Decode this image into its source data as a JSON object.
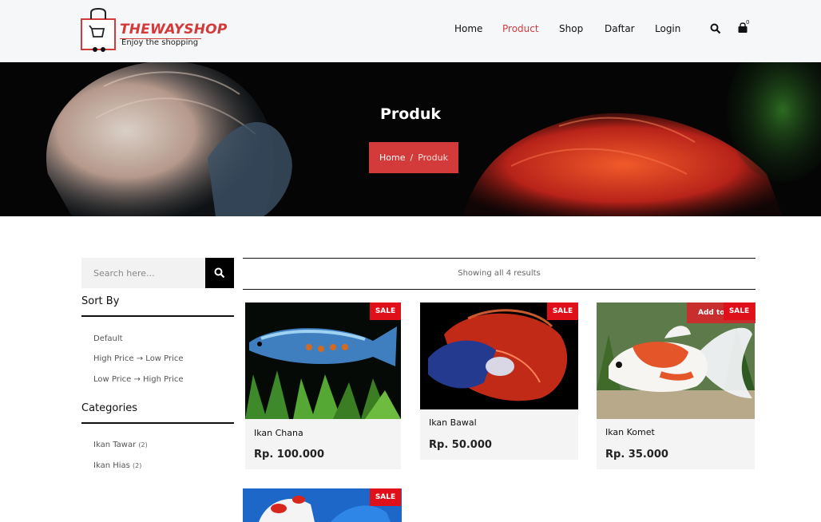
{
  "brand": {
    "title": "THEWAYSHOP",
    "tagline": "Enjoy the shopping",
    "accent": "#d33b3b"
  },
  "nav": {
    "items": [
      "Home",
      "Product",
      "Shop",
      "Daftar",
      "Login"
    ],
    "active": "Product"
  },
  "cart": {
    "count": "0"
  },
  "hero": {
    "title": "Produk",
    "breadcrumb": {
      "home": "Home",
      "sep": "/",
      "current": "Produk"
    }
  },
  "sidebar": {
    "search_placeholder": "Search here...",
    "sort_heading": "Sort By",
    "sort_options": [
      "Default",
      "High Price → Low Price",
      "Low Price → High Price"
    ],
    "categories_heading": "Categories",
    "categories": [
      {
        "label": "Ikan Tawar",
        "count": "(2)"
      },
      {
        "label": "Ikan Hias",
        "count": "(2)"
      }
    ]
  },
  "results": {
    "text": "Showing all 4 results"
  },
  "products": [
    {
      "name": "Ikan Chana",
      "price": "Rp. 100.000",
      "badge": "SALE"
    },
    {
      "name": "Ikan Bawal",
      "price": "Rp. 50.000",
      "badge": "SALE"
    },
    {
      "name": "Ikan Komet",
      "price": "Rp. 35.000",
      "badge": "SALE",
      "hover_action": "Add to"
    },
    {
      "badge": "SALE"
    }
  ]
}
